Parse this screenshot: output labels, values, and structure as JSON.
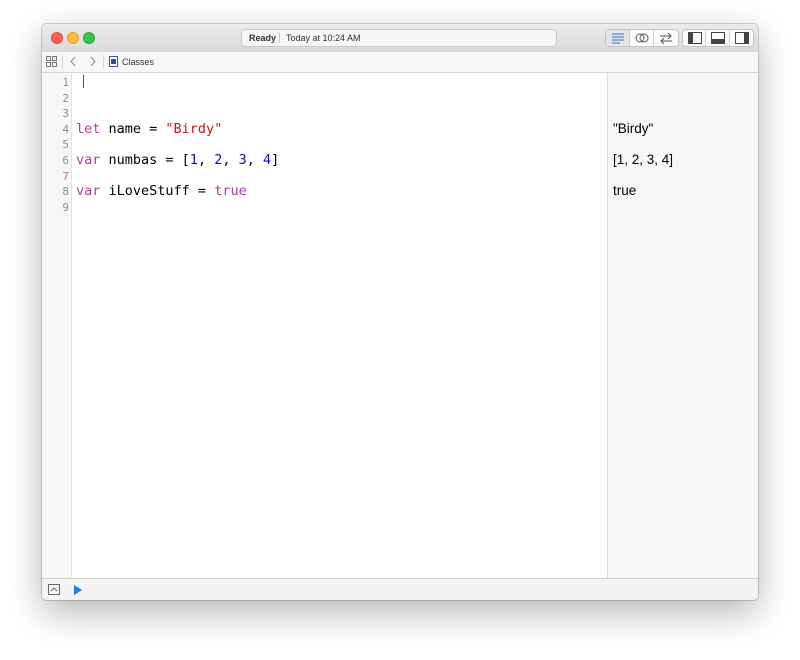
{
  "window": {
    "activity": {
      "status": "Ready",
      "time": "Today at 10:24 AM"
    }
  },
  "pathbar": {
    "file_name": "Classes"
  },
  "icons": {
    "grid": "grid-icon",
    "back": "chevron-left-icon",
    "forward": "chevron-right-icon",
    "file": "playground-file-icon",
    "standard_editor": "standard-editor-icon",
    "assistant_editor": "assistant-editor-icon",
    "version_editor": "version-editor-icon",
    "navigator": "navigator-toggle-icon",
    "debug_area": "debug-area-toggle-icon",
    "utilities": "utilities-toggle-icon",
    "console": "console-toggle-icon",
    "run": "play-icon"
  },
  "colors": {
    "keyword": "#ad3da4",
    "string": "#c41a16",
    "number": "#1c00cf",
    "run": "#1a7cf0"
  },
  "editor": {
    "line_numbers": [
      "1",
      "2",
      "3",
      "4",
      "5",
      "6",
      "7",
      "8",
      "9"
    ],
    "code": {
      "l4": {
        "kw": "let",
        "rest": " name = ",
        "str": "\"Birdy\""
      },
      "l6": {
        "kw": "var",
        "rest": " numbas = [",
        "n1": "1",
        "c1": ", ",
        "n2": "2",
        "c2": ", ",
        "n3": "3",
        "c3": ", ",
        "n4": "4",
        "close": "]"
      },
      "l8": {
        "kw": "var",
        "rest": " iLoveStuff = ",
        "val": "true"
      }
    }
  },
  "results": {
    "r4": "\"Birdy\"",
    "r6": "[1, 2, 3, 4]",
    "r8": "true"
  }
}
